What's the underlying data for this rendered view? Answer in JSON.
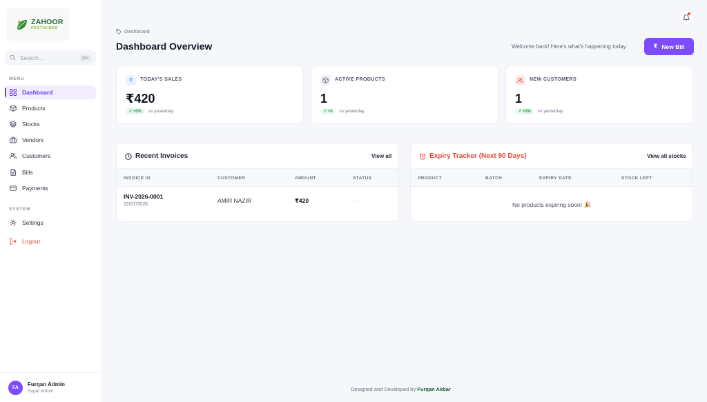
{
  "brand": {
    "name": "ZAHOOR",
    "tagline": "PESTICIDES"
  },
  "search": {
    "placeholder": "Search...",
    "shortcut": "⌘K"
  },
  "sidebar": {
    "menu_label": "MENU",
    "items": [
      {
        "label": "Dashboard",
        "icon": "grid-icon",
        "active": true
      },
      {
        "label": "Products",
        "icon": "box-icon"
      },
      {
        "label": "Stocks",
        "icon": "layers-icon"
      },
      {
        "label": "Vendors",
        "icon": "briefcase-icon"
      },
      {
        "label": "Customers",
        "icon": "users-icon"
      },
      {
        "label": "Bills",
        "icon": "file-icon"
      },
      {
        "label": "Payments",
        "icon": "credit-card-icon"
      }
    ],
    "system_label": "SYSTEM",
    "settings_label": "Settings",
    "logout_label": "Logout"
  },
  "user": {
    "initials": "FA",
    "name": "Furqan Admin",
    "role": "Super Admin"
  },
  "header": {
    "breadcrumb": "Dashboard",
    "title": "Dashboard Overview",
    "welcome": "Welcome back! Here's what's happening today.",
    "new_bill_label": "New Bill"
  },
  "stats": [
    {
      "label": "TODAY'S SALES",
      "value": "₹420",
      "trend": "+0%",
      "compare": "vs yesterday",
      "icon": "rupee-icon",
      "accent": "#3b82f6"
    },
    {
      "label": "ACTIVE PRODUCTS",
      "value": "1",
      "trend": "+0",
      "compare": "vs yesterday",
      "icon": "box-icon",
      "accent": "#6b7280"
    },
    {
      "label": "NEW CUSTOMERS",
      "value": "1",
      "trend": "+0%",
      "compare": "vs yesterday",
      "icon": "users-icon",
      "accent": "#ef4444"
    }
  ],
  "invoices": {
    "title": "Recent Invoices",
    "view_all": "View all",
    "columns": [
      "INVOICE ID",
      "CUSTOMER",
      "AMOUNT",
      "STATUS"
    ],
    "rows": [
      {
        "id": "INV-2026-0001",
        "date": "22/07/2026",
        "customer": "AMIR NAZIR",
        "amount": "₹420",
        "status": "—"
      }
    ]
  },
  "expiry": {
    "title": "Expiry Tracker (Next 90 Days)",
    "view_all": "View all stocks",
    "columns": [
      "PRODUCT",
      "BATCH",
      "EXPIRY DATE",
      "STOCK LEFT"
    ],
    "empty": "No products expiring soon! 🎉"
  },
  "footer": {
    "prefix": "Designed and Developed by",
    "author": "Furqan Akbar"
  },
  "colors": {
    "accent": "#7c4dff",
    "danger": "#e44a3c",
    "brand": "#1f6b3a"
  }
}
